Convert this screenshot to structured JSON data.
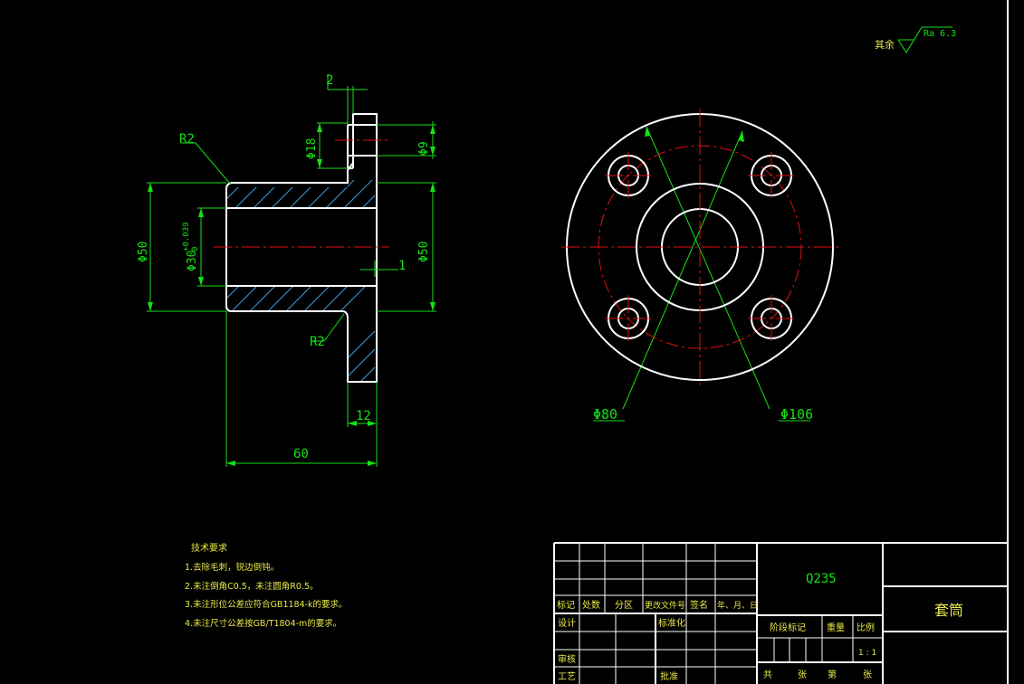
{
  "drawing": {
    "surface_roughness": {
      "prefix": "其余",
      "value": "Ra 6.3"
    },
    "side_view": {
      "dim_top_gap": "2",
      "dim_hole_bore": "Φ18",
      "dim_hole_small": "Φ9",
      "radius_top": "R2",
      "radius_bottom": "R2",
      "dim_outer_left": "Φ50",
      "dim_bore": "Φ30",
      "dim_bore_tol_upper": "+0.039",
      "dim_bore_tol_lower": "0",
      "dim_outer_right": "Φ50",
      "dim_chamfer": "1",
      "dim_flange_thickness": "12",
      "dim_total_length": "60"
    },
    "front_view": {
      "dim_pcd": "Φ80",
      "dim_flange_outer": "Φ106"
    },
    "technical_requirements": {
      "title": "技术要求",
      "items": [
        "1.去除毛刺，锐边倒钝。",
        "2.未注倒角C0.5，未注圆角R0.5。",
        "3.未注形位公差应符合GB1184-k的要求。",
        "4.未注尺寸公差按GB/T1804-m的要求。"
      ]
    }
  },
  "title_block": {
    "revision_headers": [
      "标记",
      "处数",
      "分区",
      "更改文件号",
      "签名",
      "年、月、日"
    ],
    "role_design": "设计",
    "role_standardize": "标准化",
    "role_review": "审核",
    "role_process": "工艺",
    "role_approve": "批准",
    "material": "Q235",
    "part_name": "套筒",
    "stage_mark": "阶段标记",
    "weight": "重量",
    "scale": "比例",
    "scale_value": "1 : 1",
    "sheet_total": "共",
    "sheet_unit": "张",
    "sheet_number": "第",
    "sheet_unit2": "张"
  },
  "colors": {
    "outline": "#ffffff",
    "dimension": "#16e016",
    "centerline": "#e01010",
    "hatch": "#3aa0e0",
    "frame": "#ffffff"
  }
}
